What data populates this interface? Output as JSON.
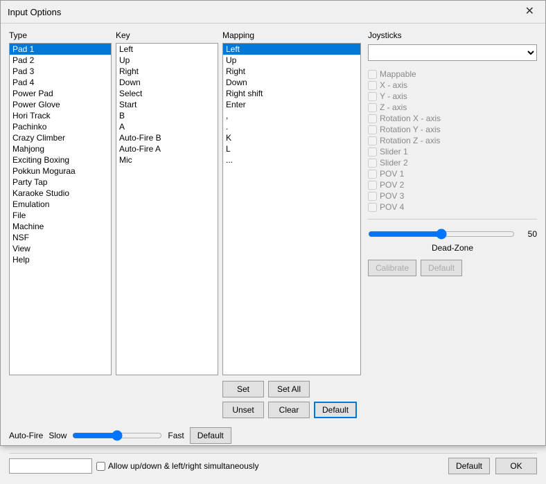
{
  "title": "Input Options",
  "close_button": "✕",
  "type_label": "Type",
  "key_label": "Key",
  "mapping_label": "Mapping",
  "joysticks_label": "Joysticks",
  "type_items": [
    "Pad 1",
    "Pad 2",
    "Pad 3",
    "Pad 4",
    "Power Pad",
    "Power Glove",
    "Hori Track",
    "Pachinko",
    "Crazy Climber",
    "Mahjong",
    "Exciting Boxing",
    "Pokkun Moguraa",
    "Party Tap",
    "Karaoke Studio",
    "Emulation",
    "File",
    "Machine",
    "NSF",
    "View",
    "Help"
  ],
  "key_items": [
    "Left",
    "Up",
    "Right",
    "Down",
    "Select",
    "Start",
    "B",
    "A",
    "Auto-Fire B",
    "Auto-Fire A",
    "Mic"
  ],
  "mapping_items": [
    "Left",
    "Up",
    "Right",
    "Down",
    "Right shift",
    "Enter",
    ",",
    ".",
    "K",
    "L",
    "..."
  ],
  "checkboxes": [
    "Mappable",
    "X - axis",
    "Y - axis",
    "Z - axis",
    "Rotation X - axis",
    "Rotation Y - axis",
    "Rotation Z - axis",
    "Slider 1",
    "Slider 2",
    "POV 1",
    "POV 2",
    "POV 3",
    "POV 4"
  ],
  "deadzone_value": "50",
  "deadzone_label": "Dead-Zone",
  "calibrate_label": "Calibrate",
  "joystick_default_label": "Default",
  "autofire_label": "Auto-Fire",
  "slow_label": "Slow",
  "fast_label": "Fast",
  "autofire_default_label": "Default",
  "set_label": "Set",
  "set_all_label": "Set All",
  "unset_label": "Unset",
  "clear_label": "Clear",
  "mapping_default_label": "Default",
  "allow_checkbox_label": "Allow up/down & left/right simultaneously",
  "bottom_default_label": "Default",
  "ok_label": "OK"
}
